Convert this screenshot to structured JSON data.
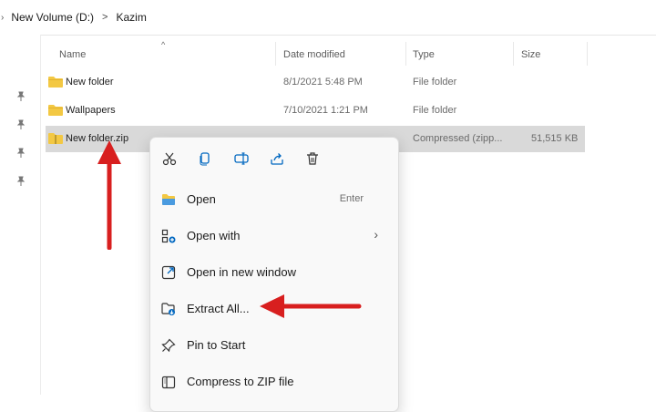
{
  "breadcrumb": {
    "lead": "›",
    "drive": "New Volume (D:)",
    "separator": ">",
    "folder": "Kazim"
  },
  "columns": {
    "name": "Name",
    "date": "Date modified",
    "type": "Type",
    "size": "Size"
  },
  "files": [
    {
      "name": "New folder",
      "date": "8/1/2021 5:48 PM",
      "type": "File folder",
      "size": ""
    },
    {
      "name": "Wallpapers",
      "date": "7/10/2021 1:21 PM",
      "type": "File folder",
      "size": ""
    },
    {
      "name": "New folder.zip",
      "date": "",
      "type": "Compressed (zipp...",
      "size": "51,515 KB"
    }
  ],
  "context_menu": {
    "quick_actions": [
      "cut-icon",
      "copy-icon",
      "rename-icon",
      "share-icon",
      "delete-icon"
    ],
    "items": [
      {
        "label": "Open",
        "hint": "Enter",
        "icon": "folder-open-icon"
      },
      {
        "label": "Open with",
        "chevron": "›",
        "icon": "open-with-icon"
      },
      {
        "label": "Open in new window",
        "icon": "new-window-icon"
      },
      {
        "label": "Extract All...",
        "icon": "extract-icon"
      },
      {
        "label": "Pin to Start",
        "icon": "pin-icon"
      },
      {
        "label": "Compress to ZIP file",
        "icon": "compress-icon"
      }
    ]
  },
  "colors": {
    "accent": "#0067c0",
    "arrow": "#d81f1f",
    "folder": "#f3c843",
    "selection": "#d9d9d9"
  }
}
